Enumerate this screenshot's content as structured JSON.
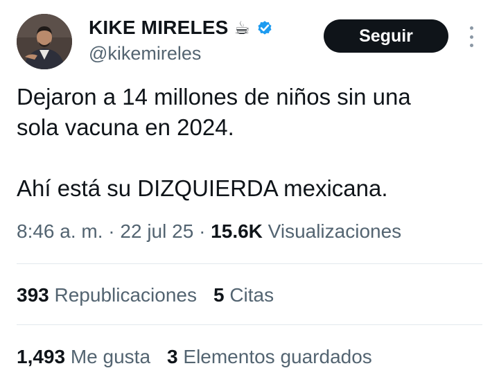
{
  "author": {
    "display_name": "KIKE MIRELES",
    "emoji": "☕",
    "handle": "@kikemireles",
    "verified_color": "#1d9bf0"
  },
  "follow_button": {
    "label": "Seguir"
  },
  "tweet": {
    "line1": "Dejaron a 14 millones de niños sin una",
    "line2": "sola vacuna en 2024.",
    "line3": "Ahí está su DIZQUIERDA mexicana."
  },
  "meta": {
    "time": "8:46 a. m.",
    "sep": "·",
    "date": "22 jul 25",
    "views_count": "15.6K",
    "views_label": "Visualizaciones"
  },
  "stats": {
    "reposts_count": "393",
    "reposts_label": "Republicaciones",
    "quotes_count": "5",
    "quotes_label": "Citas",
    "likes_count": "1,493",
    "likes_label": "Me gusta",
    "bookmarks_count": "3",
    "bookmarks_label": "Elementos guardados"
  },
  "icons": {
    "more": "more-vertical-icon",
    "verified": "verified-badge-icon"
  }
}
